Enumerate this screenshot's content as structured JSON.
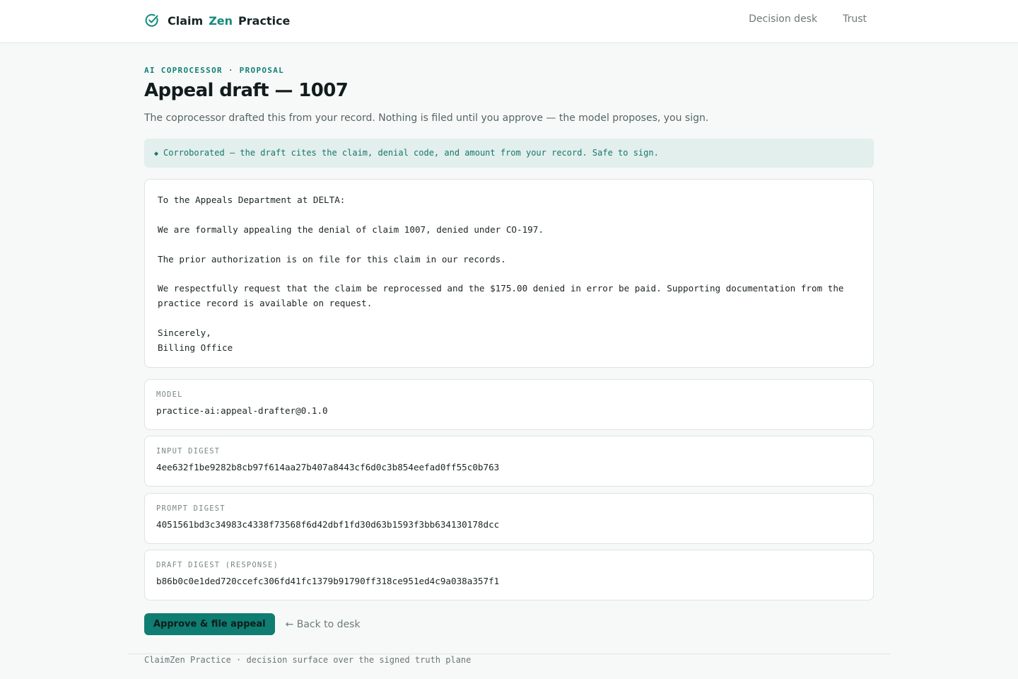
{
  "app": {
    "brand_part1": "Claim",
    "brand_part2": "Zen",
    "brand_part3": "Practice",
    "logo_icon": "check-circle-icon"
  },
  "nav": {
    "items": [
      {
        "label": "Decision desk"
      },
      {
        "label": "Trust"
      }
    ]
  },
  "page": {
    "eyebrow": "AI COPROCESSOR · PROPOSAL",
    "title": "Appeal draft — 1007",
    "lede": "The coprocessor drafted this from your record. Nothing is filed until you approve — the model proposes, you sign."
  },
  "banner": {
    "icon": "◆",
    "text": "Corroborated — the draft cites the claim, denial code, and amount from your record. Safe to sign."
  },
  "letter": {
    "salutation": "To the Appeals Department at DELTA:",
    "para1": "We are formally appealing the denial of claim 1007, denied under CO-197.",
    "para2": "The prior authorization is on file for this claim in our records.",
    "para3": "We respectfully request that the claim be reprocessed and the $175.00 denied in error be paid. Supporting documentation from the practice record is available on request.",
    "closing": "Sincerely,",
    "signature": "Billing Office"
  },
  "provenance": {
    "model": {
      "label": "MODEL",
      "value": "practice-ai:appeal-drafter@0.1.0"
    },
    "input_digest": {
      "label": "INPUT DIGEST",
      "value": "4ee632f1be9282b8cb97f614aa27b407a8443cf6d0c3b854eefad0ff55c0b763"
    },
    "prompt_digest": {
      "label": "PROMPT DIGEST",
      "value": "4051561bd3c34983c4338f73568f6d42dbf1fd30d63b1593f3bb634130178dcc"
    },
    "draft_digest": {
      "label": "DRAFT DIGEST (RESPONSE)",
      "value": "b86b0c0e1ded720ccefc306fd41fc1379b91790ff318ce951ed4c9a038a357f1"
    }
  },
  "actions": {
    "approve_label": "Approve & file appeal",
    "back_label": "← Back to desk"
  },
  "footer": {
    "text": "ClaimZen Practice · decision surface over the signed truth plane"
  },
  "colors": {
    "accent": "#0f7d71",
    "banner_bg": "#e2efec",
    "banner_text": "#16766b"
  }
}
